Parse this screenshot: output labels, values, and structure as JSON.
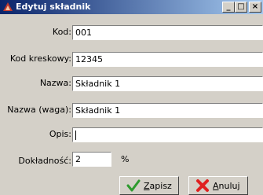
{
  "window": {
    "title": "Edytuj składnik",
    "controls": {
      "minimize": "_",
      "maximize": "□",
      "close": "×"
    }
  },
  "form": {
    "kod": {
      "label": "Kod:",
      "value": "001"
    },
    "kod_kreskowy": {
      "label": "Kod kreskowy:",
      "value": "12345"
    },
    "nazwa": {
      "label": "Nazwa:",
      "value": "Składnik 1"
    },
    "nazwa_waga": {
      "label": "Nazwa (waga):",
      "value": "Składnik 1"
    },
    "opis": {
      "label": "Opis:",
      "value": ""
    },
    "dokladnosc": {
      "label": "Dokładność:",
      "value": "2",
      "unit": "%"
    }
  },
  "buttons": {
    "save": {
      "mnemonic": "Z",
      "rest": "apisz"
    },
    "cancel": {
      "mnemonic": "A",
      "rest": "nuluj"
    }
  },
  "colors": {
    "titlebar_start": "#0a246a",
    "titlebar_end": "#a6caf0",
    "dialog_bg": "#d4d0c8"
  },
  "icons": {
    "title": "app-icon",
    "save": "checkmark-icon",
    "cancel": "cross-icon"
  }
}
